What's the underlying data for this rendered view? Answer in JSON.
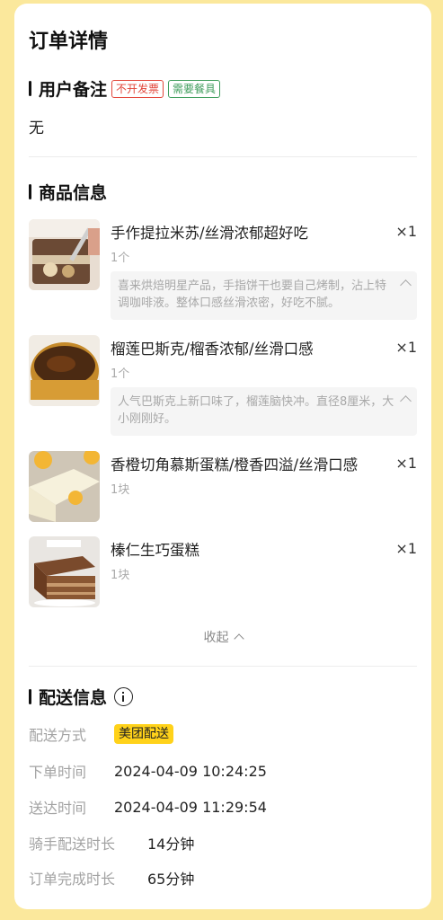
{
  "page": {
    "title": "订单详情"
  },
  "remark": {
    "heading": "用户备注",
    "tags": [
      "不开发票",
      "需要餐具"
    ],
    "text": "无"
  },
  "goods": {
    "heading": "商品信息",
    "items": [
      {
        "name": "手作提拉米苏/丝滑浓郁超好吃",
        "qty": "×1",
        "unit": "1个",
        "desc": "喜来烘焙明星产品，手指饼干也要自己烤制，沾上特调咖啡液。整体口感丝滑浓密，好吃不腻。"
      },
      {
        "name": "榴莲巴斯克/榴香浓郁/丝滑口感",
        "qty": "×1",
        "unit": "1个",
        "desc": "人气巴斯克上新口味了，榴莲脑快冲。直径8厘米，大小刚刚好。"
      },
      {
        "name": "香橙切角慕斯蛋糕/橙香四溢/丝滑口感",
        "qty": "×1",
        "unit": "1块",
        "desc": ""
      },
      {
        "name": "榛仁生巧蛋糕",
        "qty": "×1",
        "unit": "1块",
        "desc": ""
      }
    ],
    "collapse_label": "收起"
  },
  "delivery": {
    "heading": "配送信息",
    "rows": [
      {
        "label": "配送方式",
        "value": "美团配送"
      },
      {
        "label": "下单时间",
        "value": "2024-04-09 10:24:25"
      },
      {
        "label": "送达时间",
        "value": "2024-04-09 11:29:54"
      },
      {
        "label": "骑手配送时长",
        "value": "14分钟"
      },
      {
        "label": "订单完成时长",
        "value": "65分钟"
      }
    ]
  },
  "colors": {
    "background": "#fbe89c",
    "badge": "#ffd21a",
    "tag_red": "#e2463a",
    "tag_green": "#3f9d5c"
  }
}
